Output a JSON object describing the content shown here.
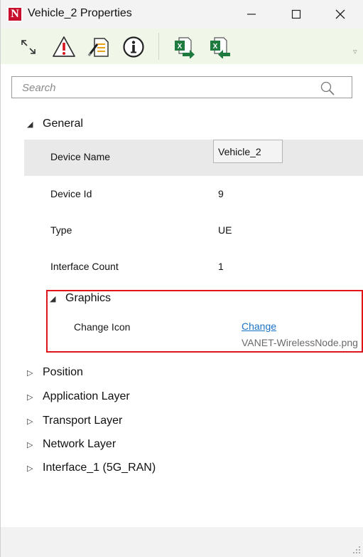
{
  "window": {
    "title": "Vehicle_2 Properties",
    "app_logo_letter": "N",
    "minimize_icon": "minimize-icon",
    "maximize_icon": "maximize-icon",
    "close_icon": "close-icon"
  },
  "toolbar": {
    "icons": [
      "expand-collapse-icon",
      "warning-icon",
      "edit-document-icon",
      "info-icon",
      "excel-export-icon",
      "excel-import-icon"
    ]
  },
  "search": {
    "placeholder": "Search",
    "value": ""
  },
  "general": {
    "label": "General",
    "rows": [
      {
        "name": "Device Name",
        "value": "Vehicle_2"
      },
      {
        "name": "Device Id",
        "value": "9"
      },
      {
        "name": "Type",
        "value": "UE"
      },
      {
        "name": "Interface Count",
        "value": "1"
      }
    ],
    "graphics": {
      "label": "Graphics",
      "change_icon_label": "Change Icon",
      "change_link": "Change",
      "icon_file": "VANET-WirelessNode.png"
    }
  },
  "collapsed_sections": [
    "Position",
    "Application Layer",
    "Transport Layer",
    "Network Layer",
    "Interface_1 (5G_RAN)"
  ],
  "colors": {
    "toolbar_bg": "#f0f7e9",
    "highlight": "#e0151b",
    "link": "#1a73c7",
    "selected_row": "#e9e9e9"
  }
}
